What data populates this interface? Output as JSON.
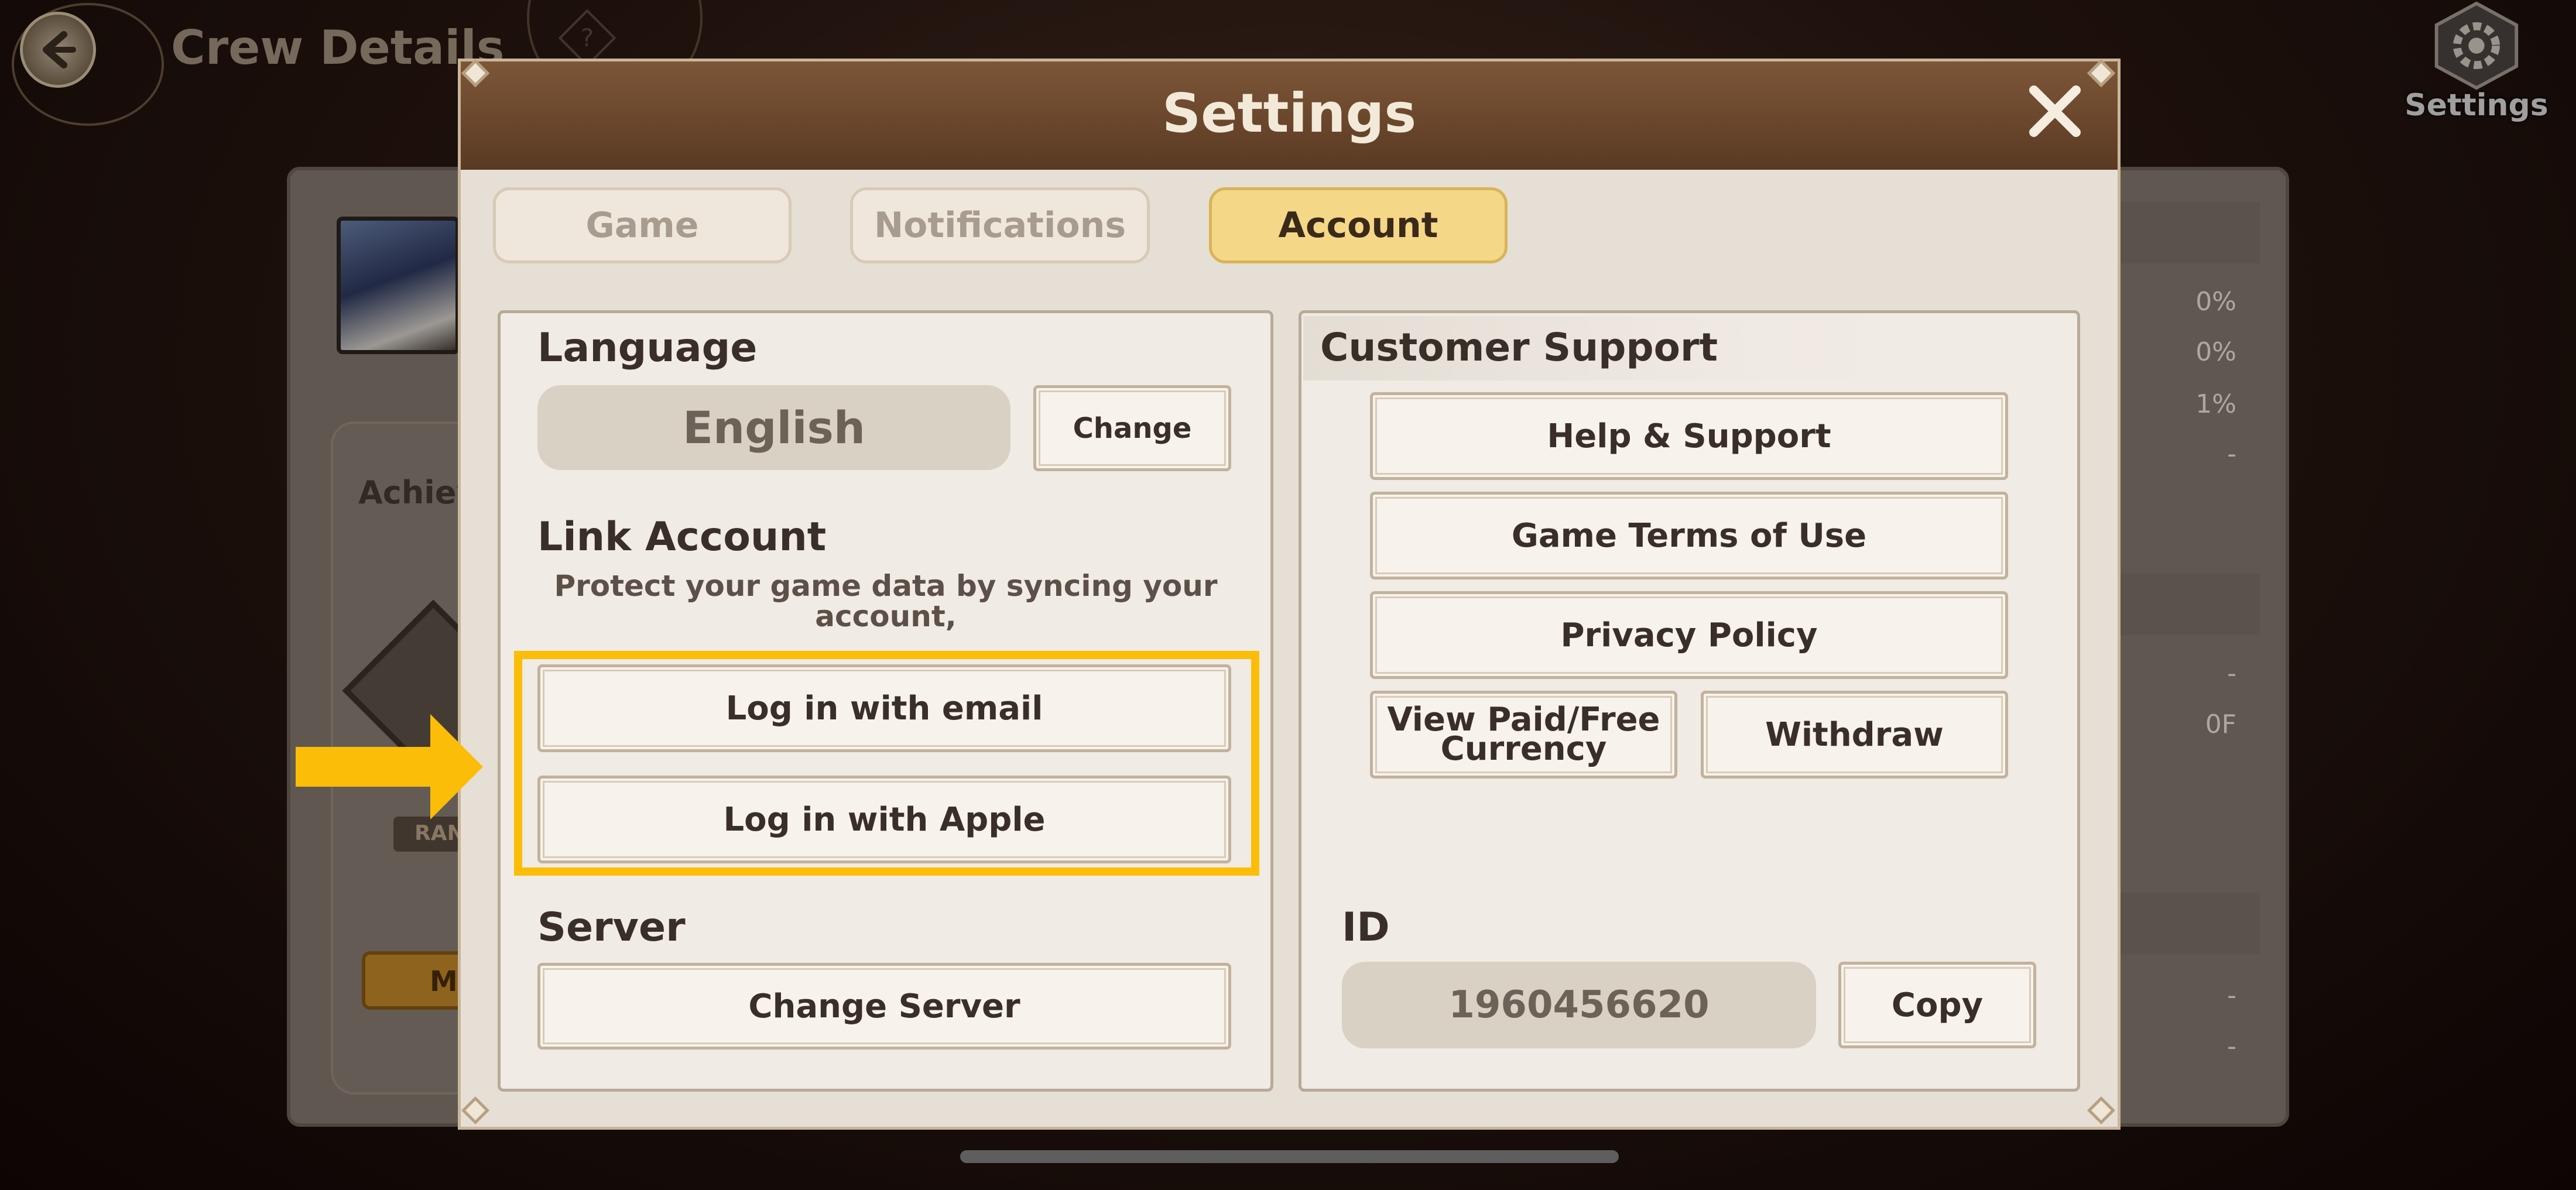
{
  "background": {
    "header_title": "Crew Details",
    "help_glyph": "?",
    "settings_button_label": "Settings",
    "achievements_label": "Achiev",
    "rank_badge": "RAN",
    "bottom_button_partial": "M",
    "stats": [
      "0%",
      "0%",
      "1%",
      "-",
      "-",
      "0F",
      "-",
      "-"
    ]
  },
  "dialog": {
    "title": "Settings",
    "tabs": [
      {
        "label": "Game",
        "active": false
      },
      {
        "label": "Notifications",
        "active": false
      },
      {
        "label": "Account",
        "active": true
      }
    ],
    "left": {
      "language_label": "Language",
      "language_value": "English",
      "change_button": "Change",
      "link_account_label": "Link Account",
      "link_account_desc_line1": "Protect your game data by syncing your",
      "link_account_desc_line2": "account,",
      "login_email_button": "Log in with email",
      "login_apple_button": "Log in with Apple",
      "server_label": "Server",
      "change_server_button": "Change Server"
    },
    "right": {
      "support_label": "Customer Support",
      "help_button": "Help & Support",
      "terms_button": "Game Terms of Use",
      "privacy_button": "Privacy Policy",
      "currency_button_line1": "View Paid/Free",
      "currency_button_line2": "Currency",
      "withdraw_button": "Withdraw",
      "id_label": "ID",
      "id_value": "1960456620",
      "copy_button": "Copy"
    }
  },
  "colors": {
    "highlight": "#fcbd08",
    "active_tab": "#f5d788",
    "title_bar": "#6b4a30"
  },
  "icons": [
    "back-arrow-icon",
    "gear-icon",
    "close-icon",
    "pointer-arrow-icon"
  ]
}
